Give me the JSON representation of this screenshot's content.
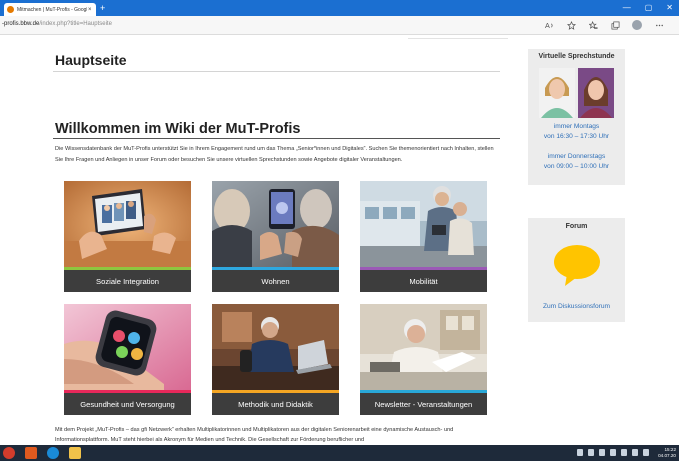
{
  "browser": {
    "tab_title": "Mitmachen | MuT-Profis - Google Chrome",
    "tab_close": "×",
    "new_tab": "+",
    "url_domain": "-profis.bbw.de",
    "url_path": "/index.php?title=Hauptseite",
    "win_min": "—",
    "win_max": "▢",
    "win_close": "✕"
  },
  "page": {
    "title": "Hauptseite",
    "welcome": "Willkommen im Wiki der MuT-Profis",
    "intro": "Die Wissensdatenbank der MuT-Profis unterstützt Sie in Ihrem Engagement rund um das Thema „Senior*innen und Digitales“. Suchen Sie themenorientiert nach Inhalten, stellen Sie Ihre Fragen und Anliegen in unser Forum oder besuchen Sie unsere virtuellen Sprechstunden sowie Angebote digitaler Veranstaltungen.",
    "bottom_text": "Mit dem Projekt „MuT-Profis – das gfi Netzwerk“ erhalten Multiplikatorinnen und Multiplikatoren aus der digitalen Seniorenarbeit eine dynamische Austausch- und Informationsplattform. MuT steht hierbei als Akronym für Medien und Technik. Die Gesellschaft zur Förderung beruflicher und"
  },
  "tiles": [
    {
      "label": "Soziale Integration",
      "stripe": "#8dc63f"
    },
    {
      "label": "Wohnen",
      "stripe": "#2ea8e0"
    },
    {
      "label": "Mobilität",
      "stripe": "#9b59b6"
    },
    {
      "label": "Gesundheit und Versorgung",
      "stripe": "#e8285a"
    },
    {
      "label": "Methodik und Didaktik",
      "stripe": "#f5a623"
    },
    {
      "label": "Newsletter - Veranstaltungen",
      "stripe": "#29a8d8"
    }
  ],
  "sidebar": {
    "sprechstunde": {
      "title": "Virtuelle Sprechstunde",
      "monday_day": "immer Montags",
      "monday_time": "von 16:30 – 17:30 Uhr",
      "thursday_day": "immer Donnerstags",
      "thursday_time": "von 09:00 – 10:00 Uhr"
    },
    "forum": {
      "title": "Forum",
      "link": "Zum Diskussionsforum",
      "bubble_color": "#ffc400"
    }
  },
  "taskbar": {
    "time": "15:22",
    "date": "04.07.20"
  },
  "colors": {
    "chrome_blue": "#1b6fd1",
    "link_blue": "#2e6fb8",
    "tile_dark": "#3d3d3d"
  }
}
